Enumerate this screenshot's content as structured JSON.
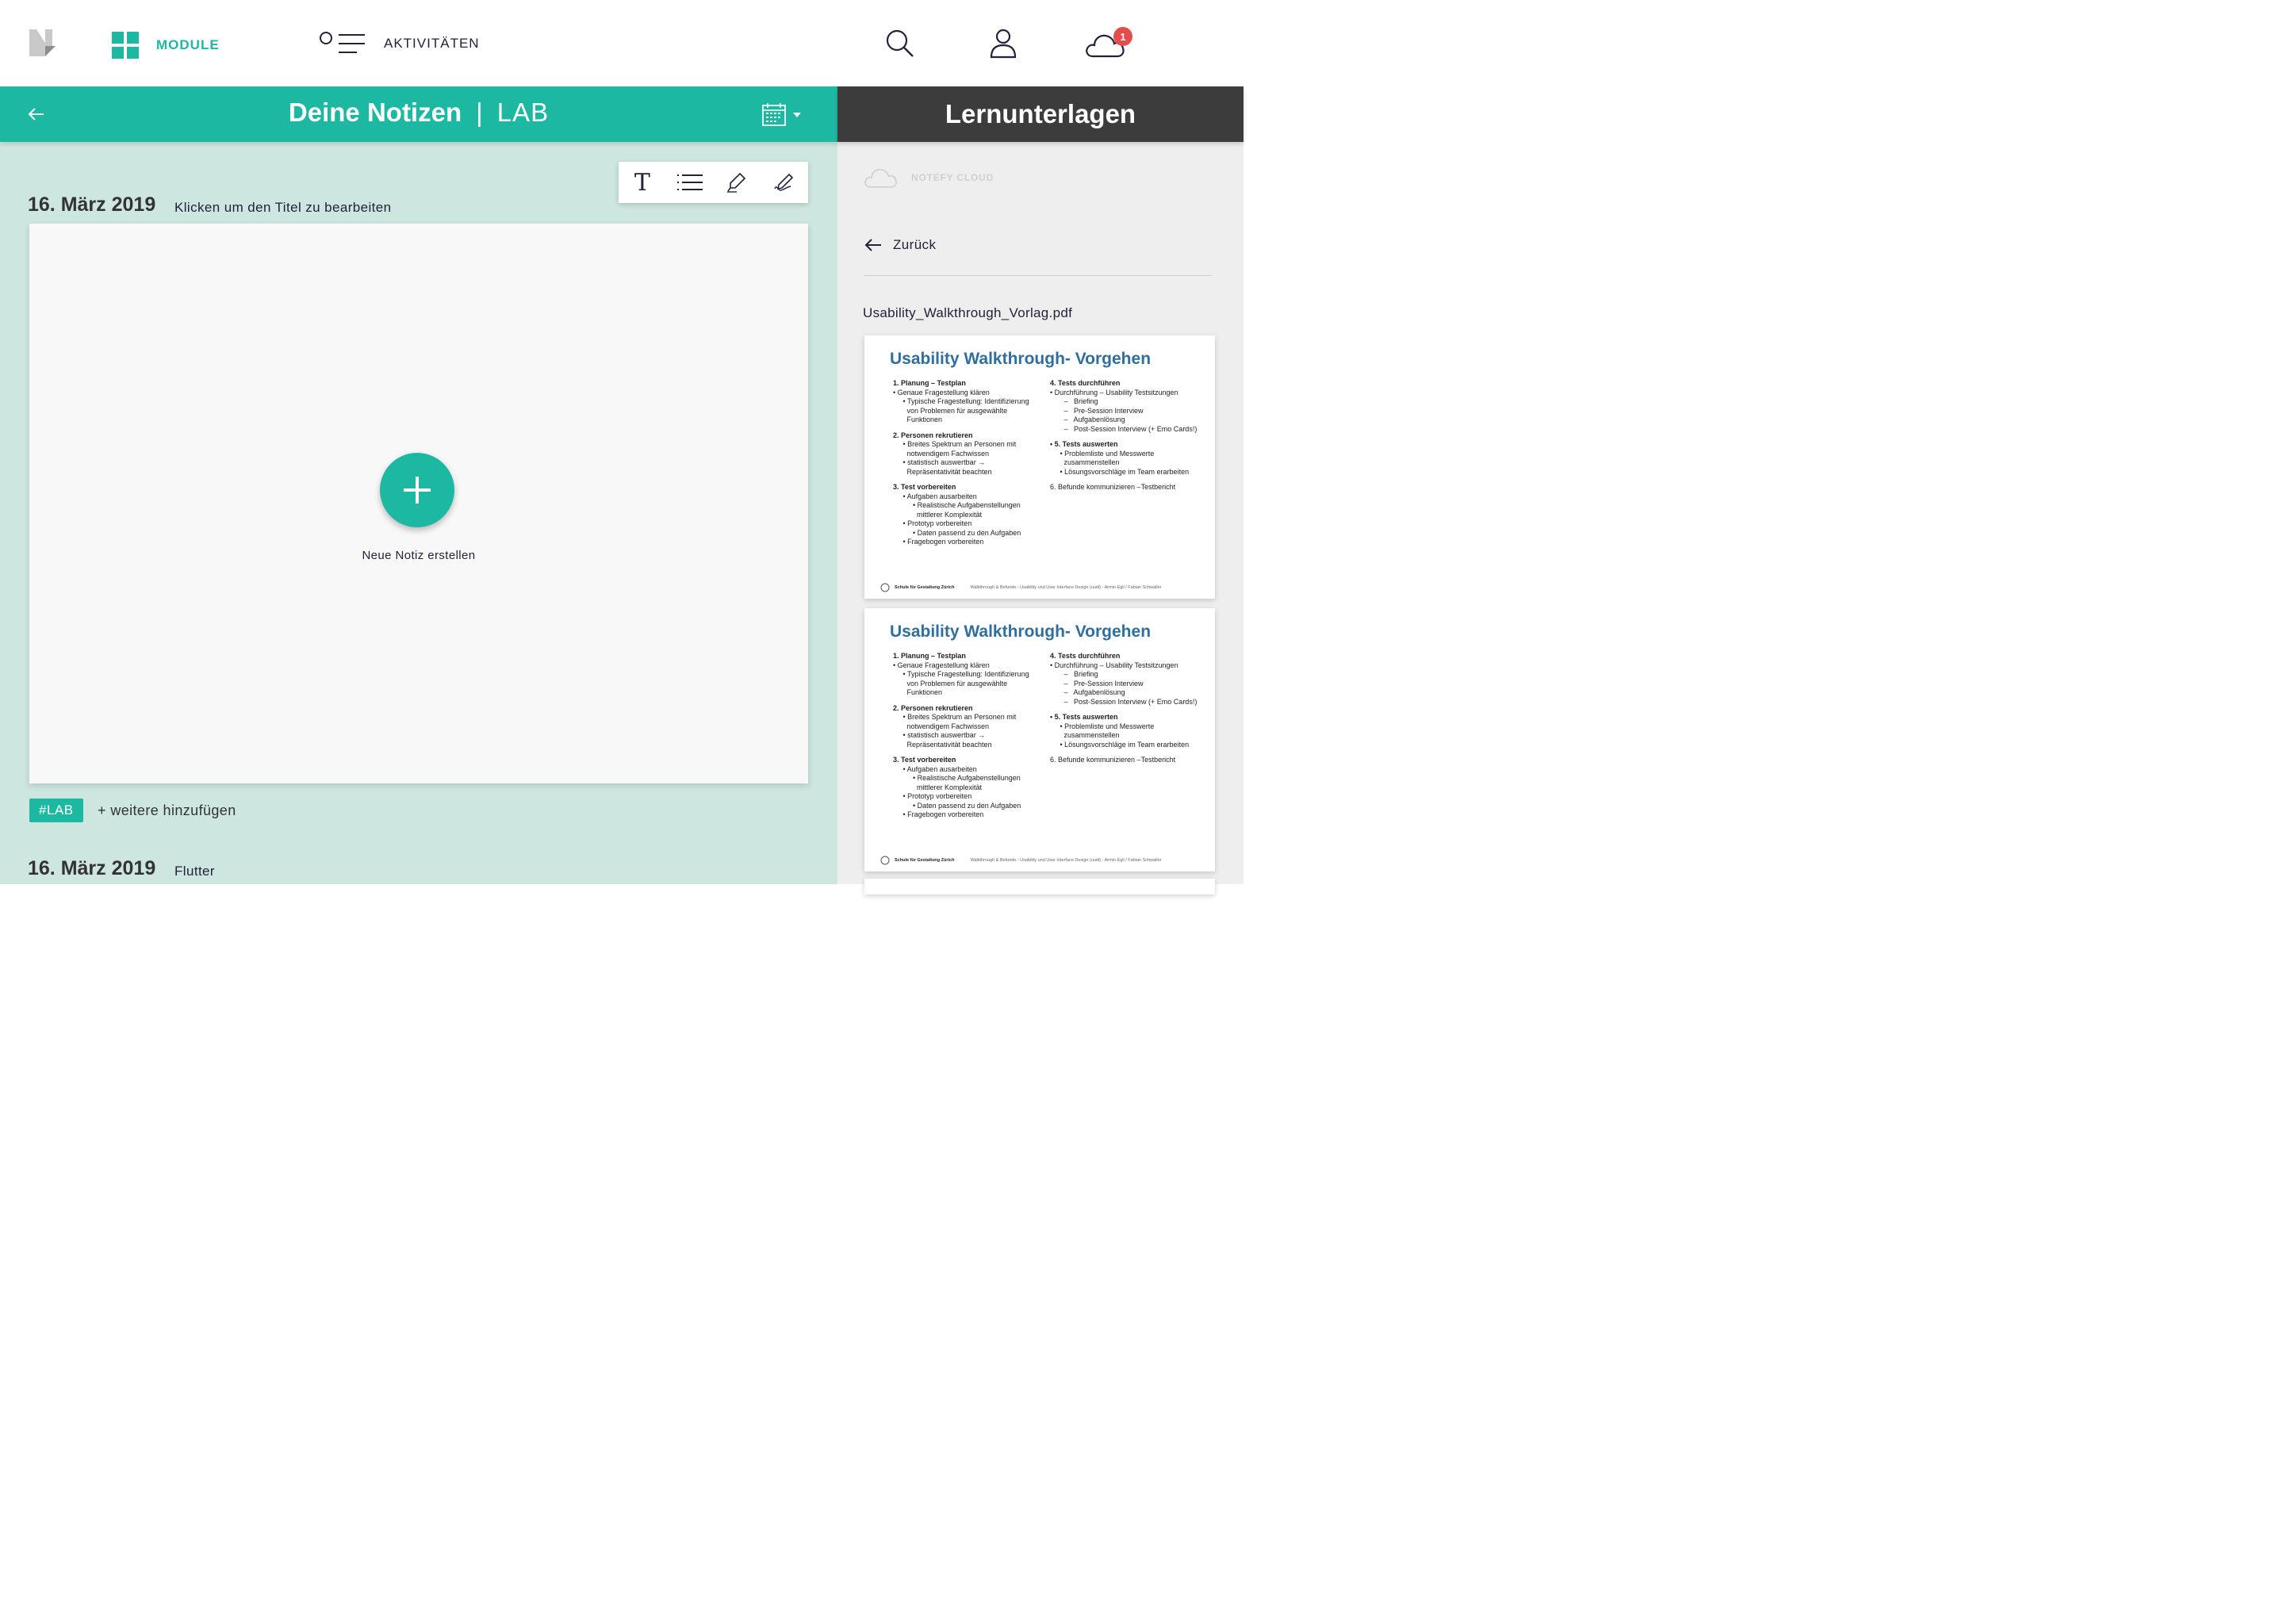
{
  "nav": {
    "module_label": "MODULE",
    "activities_label": "AKTIVITÄTEN",
    "notification_count": "1",
    "icons": [
      "logo-icon",
      "grid-icon",
      "activities-icon",
      "search-icon",
      "user-icon",
      "cloud-icon"
    ]
  },
  "notes_header": {
    "title": "Deine Notizen",
    "separator": "|",
    "subtitle": "LAB"
  },
  "side_header": {
    "title": "Lernunterlagen"
  },
  "toolbar": {
    "text_tool": "T",
    "tools": [
      "text-tool",
      "list-tool",
      "highlighter-tool",
      "pen-tool"
    ]
  },
  "notes": [
    {
      "date": "16. März 2019",
      "title": "Klicken um den Titel zu bearbeiten",
      "fab_label": "Neue Notiz erstellen",
      "tag": "#LAB",
      "add_tag_label": "+ weitere hinzufügen"
    },
    {
      "date": "16. März 2019",
      "title": "Flutter"
    }
  ],
  "side_panel": {
    "cloud_label": "NOTEFY CLOUD",
    "back_label": "Zurück",
    "file_name": "Usability_Walkthrough_Vorlag.pdf",
    "slide": {
      "title": "Usability Walkthrough- Vorgehen",
      "left_lines": [
        "1. Planung – Testplan",
        "• Genaue Fragestellung klären",
        "     • Typische Fragestellung: Identifizierung",
        "       von Problemen für ausgewählte",
        "       Funktionen",
        "",
        "2. Personen rekrutieren",
        "     • Breites Spektrum an Personen mit",
        "       notwendigem Fachwissen",
        "     • statistisch auswertbar →",
        "       Repräsentativität beachten",
        "",
        "3. Test vorbereiten",
        "     • Aufgaben ausarbeiten",
        "          • Realistische Aufgabenstellungen",
        "            mittlerer Komplexität",
        "     • Prototyp vorbereiten",
        "          • Daten passend zu den Aufgaben",
        "     • Fragebogen vorbereiten"
      ],
      "right_lines": [
        "4. Tests durchführen",
        "• Durchführung – Usability Testsitzungen",
        "       –   Briefing",
        "       –   Pre-Session Interview",
        "       –   Aufgabenlösung",
        "       –   Post-Session Interview (+ Emo Cards!)",
        "",
        "• 5. Tests auswerten",
        "     • Problemliste und Messwerte",
        "       zusammenstellen",
        "     • Lösungsvorschläge im Team erarbeiten",
        "",
        "6. Befunde kommunizieren –Testbericht"
      ],
      "bold_left": [
        0,
        6,
        12
      ],
      "bold_right": [
        0,
        7
      ],
      "footer_school": "Schule für Gestaltung Zürich",
      "footer_text": "Walkthrough & Befunde - Usability und User Interface Design (uuid) - Armin Egli / Fabian Schwaller"
    }
  },
  "colors": {
    "accent": "#1db8a2",
    "notes_bg": "#cde6e0",
    "side_header_bg": "#3c3c3c",
    "side_panel_bg": "#eeeeee",
    "badge": "#e74c4c",
    "slide_title": "#2f6f9f"
  }
}
